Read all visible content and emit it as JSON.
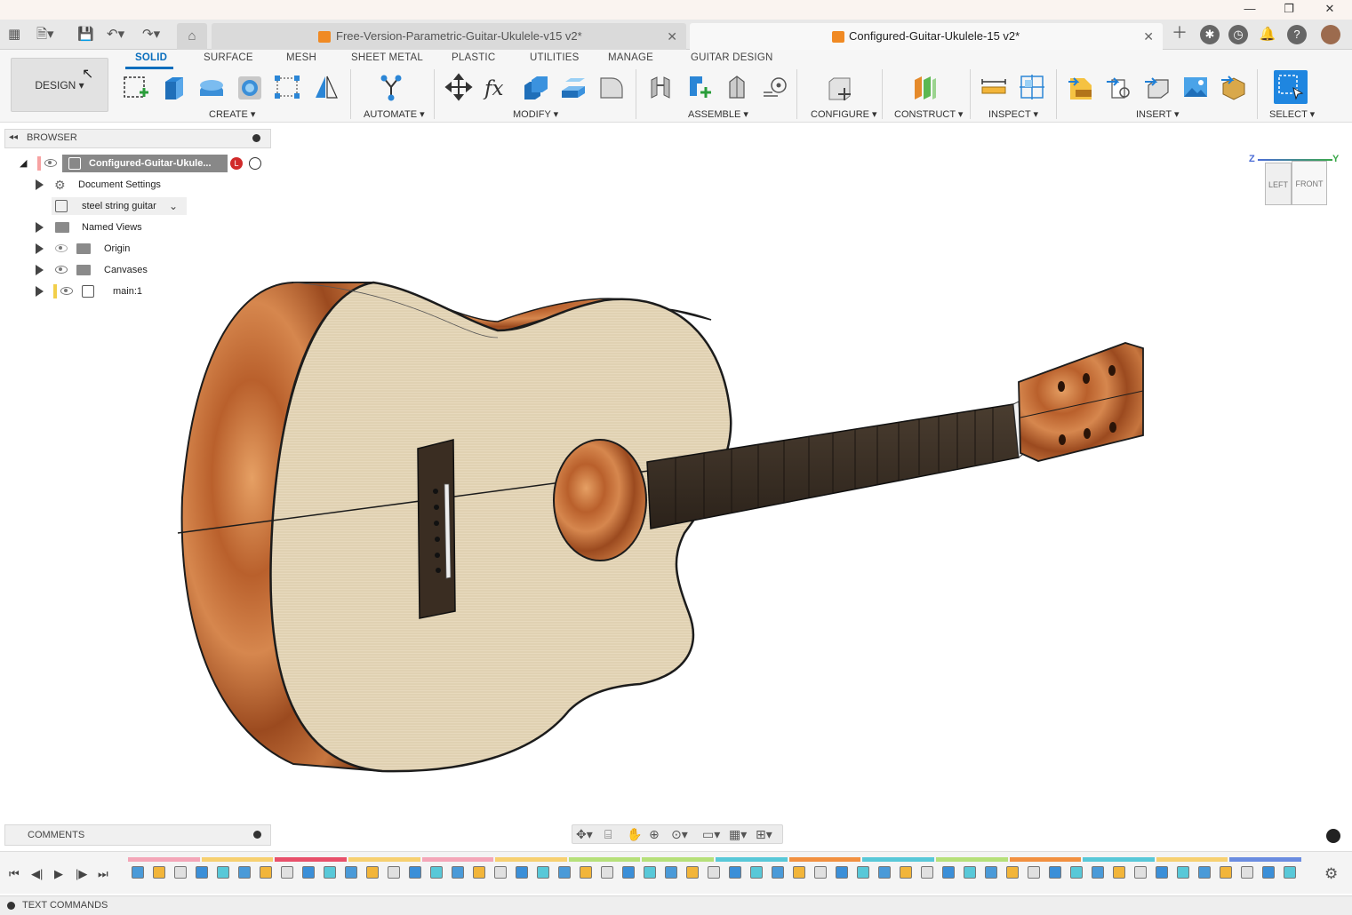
{
  "tabs": [
    {
      "label": "Free-Version-Parametric-Guitar-Ukulele-v15 v2*",
      "active": false
    },
    {
      "label": "Configured-Guitar-Ukulele-15 v2*",
      "active": true
    }
  ],
  "toolbar": {
    "design_label": "DESIGN",
    "workspace_tabs": [
      "SOLID",
      "SURFACE",
      "MESH",
      "SHEET METAL",
      "PLASTIC",
      "UTILITIES",
      "MANAGE",
      "GUITAR DESIGN"
    ],
    "groups": [
      "CREATE",
      "AUTOMATE",
      "MODIFY",
      "ASSEMBLE",
      "CONFIGURE",
      "CONSTRUCT",
      "INSPECT",
      "INSERT",
      "SELECT"
    ]
  },
  "browser": {
    "title": "BROWSER",
    "root": "Configured-Guitar-Ukule...",
    "items": [
      "Document Settings",
      "steel string guitar",
      "Named Views",
      "Origin",
      "Canvases",
      "main:1"
    ]
  },
  "viewcube": {
    "left": "LEFT",
    "front": "FRONT",
    "z": "Z",
    "y": "Y"
  },
  "comments_label": "COMMENTS",
  "text_commands_label": "TEXT COMMANDS",
  "colors": {
    "accent": "#0a6ebd",
    "spruce": "#e6d8bb",
    "rosewood": "#b0562a",
    "fretboard": "#3b3026"
  }
}
